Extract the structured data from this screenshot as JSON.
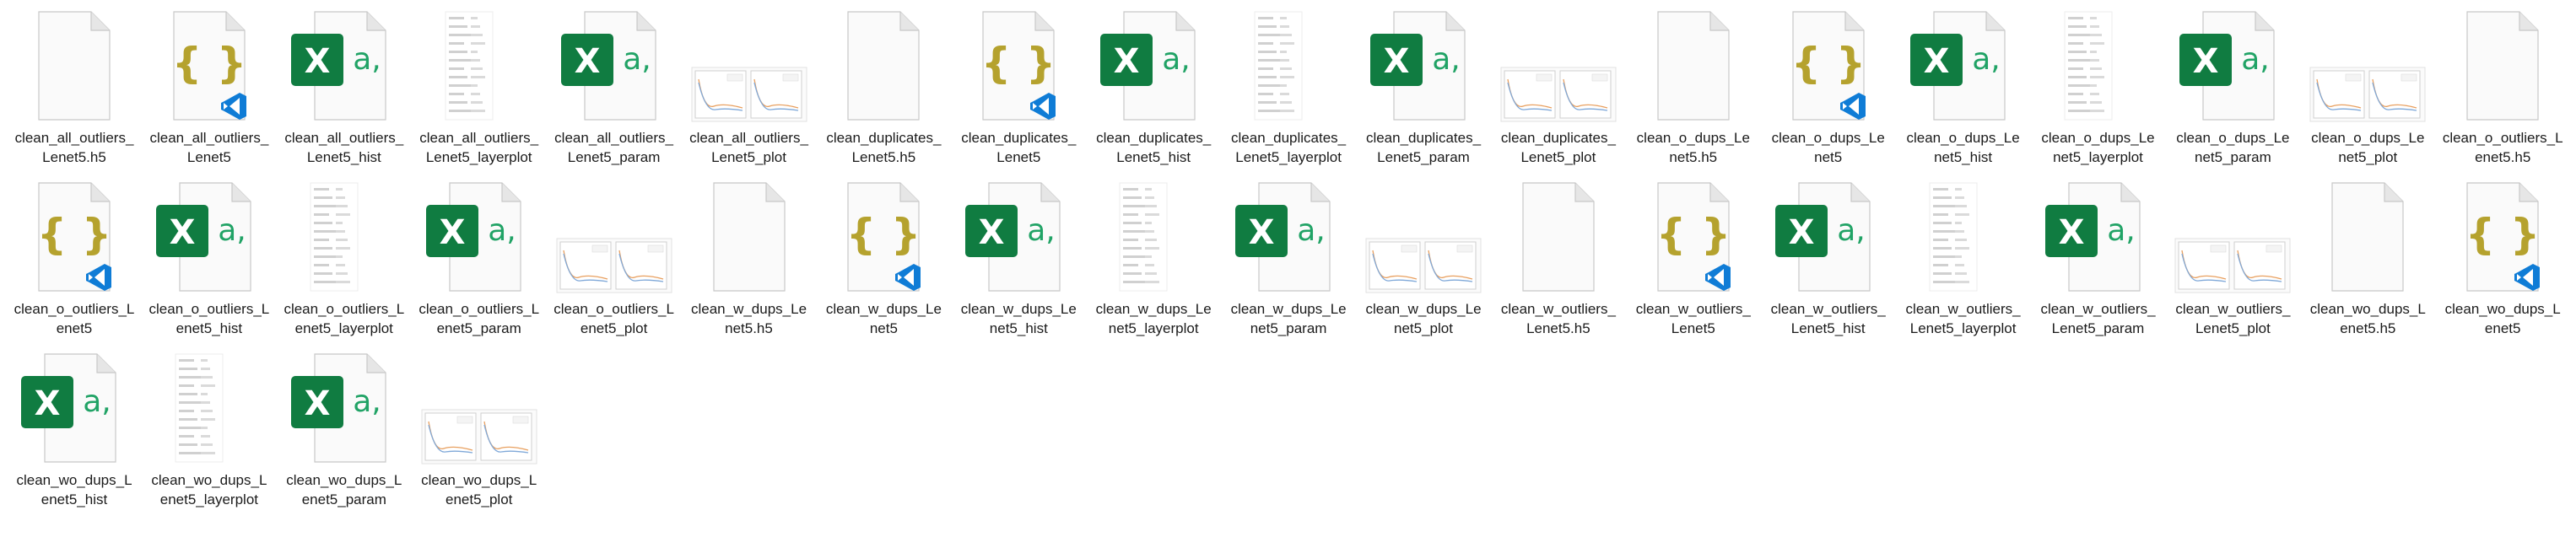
{
  "explorer": {
    "view": "Large icons",
    "files": [
      {
        "line1": "clean_all_outliers_",
        "line2": "Lenet5.h5",
        "icon": "blank-file-icon"
      },
      {
        "line1": "clean_all_outliers_",
        "line2": "Lenet5",
        "icon": "json-file-icon"
      },
      {
        "line1": "clean_all_outliers_",
        "line2": "Lenet5_hist",
        "icon": "excel-csv-icon"
      },
      {
        "line1": "clean_all_outliers_",
        "line2": "Lenet5_layerplot",
        "icon": "layerplot-thumbnail-icon"
      },
      {
        "line1": "clean_all_outliers_",
        "line2": "Lenet5_param",
        "icon": "excel-csv-icon"
      },
      {
        "line1": "clean_all_outliers_",
        "line2": "Lenet5_plot",
        "icon": "plot-thumbnail-icon"
      },
      {
        "line1": "clean_duplicates_",
        "line2": "Lenet5.h5",
        "icon": "blank-file-icon"
      },
      {
        "line1": "clean_duplicates_",
        "line2": "Lenet5",
        "icon": "json-file-icon"
      },
      {
        "line1": "clean_duplicates_",
        "line2": "Lenet5_hist",
        "icon": "excel-csv-icon"
      },
      {
        "line1": "clean_duplicates_",
        "line2": "Lenet5_layerplot",
        "icon": "layerplot-thumbnail-icon"
      },
      {
        "line1": "clean_duplicates_",
        "line2": "Lenet5_param",
        "icon": "excel-csv-icon"
      },
      {
        "line1": "clean_duplicates_",
        "line2": "Lenet5_plot",
        "icon": "plot-thumbnail-icon"
      },
      {
        "line1": "clean_o_dups_Le",
        "line2": "net5.h5",
        "icon": "blank-file-icon"
      },
      {
        "line1": "clean_o_dups_Le",
        "line2": "net5",
        "icon": "json-file-icon"
      },
      {
        "line1": "clean_o_dups_Le",
        "line2": "net5_hist",
        "icon": "excel-csv-icon"
      },
      {
        "line1": "clean_o_dups_Le",
        "line2": "net5_layerplot",
        "icon": "layerplot-thumbnail-icon"
      },
      {
        "line1": "clean_o_dups_Le",
        "line2": "net5_param",
        "icon": "excel-csv-icon"
      },
      {
        "line1": "clean_o_dups_Le",
        "line2": "net5_plot",
        "icon": "plot-thumbnail-icon"
      },
      {
        "line1": "clean_o_outliers_L",
        "line2": "enet5.h5",
        "icon": "blank-file-icon"
      },
      {
        "line1": "clean_o_outliers_L",
        "line2": "enet5",
        "icon": "json-file-icon"
      },
      {
        "line1": "clean_o_outliers_L",
        "line2": "enet5_hist",
        "icon": "excel-csv-icon"
      },
      {
        "line1": "clean_o_outliers_L",
        "line2": "enet5_layerplot",
        "icon": "layerplot-thumbnail-icon"
      },
      {
        "line1": "clean_o_outliers_L",
        "line2": "enet5_param",
        "icon": "excel-csv-icon"
      },
      {
        "line1": "clean_o_outliers_L",
        "line2": "enet5_plot",
        "icon": "plot-thumbnail-icon"
      },
      {
        "line1": "clean_w_dups_Le",
        "line2": "net5.h5",
        "icon": "blank-file-icon"
      },
      {
        "line1": "clean_w_dups_Le",
        "line2": "net5",
        "icon": "json-file-icon"
      },
      {
        "line1": "clean_w_dups_Le",
        "line2": "net5_hist",
        "icon": "excel-csv-icon"
      },
      {
        "line1": "clean_w_dups_Le",
        "line2": "net5_layerplot",
        "icon": "layerplot-thumbnail-icon"
      },
      {
        "line1": "clean_w_dups_Le",
        "line2": "net5_param",
        "icon": "excel-csv-icon"
      },
      {
        "line1": "clean_w_dups_Le",
        "line2": "net5_plot",
        "icon": "plot-thumbnail-icon"
      },
      {
        "line1": "clean_w_outliers_",
        "line2": "Lenet5.h5",
        "icon": "blank-file-icon"
      },
      {
        "line1": "clean_w_outliers_",
        "line2": "Lenet5",
        "icon": "json-file-icon"
      },
      {
        "line1": "clean_w_outliers_",
        "line2": "Lenet5_hist",
        "icon": "excel-csv-icon"
      },
      {
        "line1": "clean_w_outliers_",
        "line2": "Lenet5_layerplot",
        "icon": "layerplot-thumbnail-icon"
      },
      {
        "line1": "clean_w_outliers_",
        "line2": "Lenet5_param",
        "icon": "excel-csv-icon"
      },
      {
        "line1": "clean_w_outliers_",
        "line2": "Lenet5_plot",
        "icon": "plot-thumbnail-icon"
      },
      {
        "line1": "clean_wo_dups_L",
        "line2": "enet5.h5",
        "icon": "blank-file-icon"
      },
      {
        "line1": "clean_wo_dups_L",
        "line2": "enet5",
        "icon": "json-file-icon"
      },
      {
        "line1": "clean_wo_dups_L",
        "line2": "enet5_hist",
        "icon": "excel-csv-icon"
      },
      {
        "line1": "clean_wo_dups_L",
        "line2": "enet5_layerplot",
        "icon": "layerplot-thumbnail-icon"
      },
      {
        "line1": "clean_wo_dups_L",
        "line2": "enet5_param",
        "icon": "excel-csv-icon"
      },
      {
        "line1": "clean_wo_dups_L",
        "line2": "enet5_plot",
        "icon": "plot-thumbnail-icon"
      }
    ]
  },
  "colors": {
    "excel_green": "#107c41",
    "excel_letter_green": "#21a366",
    "json_brace": "#b5a22e",
    "vscode_blue": "#0f7cd6",
    "page_fill": "#f3f3f3",
    "page_stroke": "#c8c8c8"
  }
}
